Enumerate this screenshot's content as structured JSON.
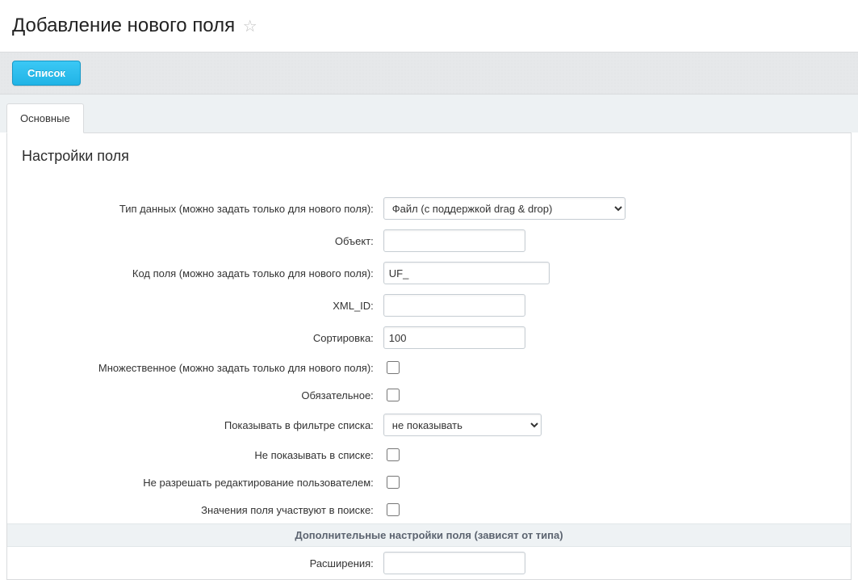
{
  "page": {
    "title": "Добавление нового поля"
  },
  "toolbar": {
    "list_label": "Список"
  },
  "tabs": {
    "main": "Основные"
  },
  "section": {
    "title": "Настройки поля",
    "sub_heading": "Дополнительные настройки поля (зависят от типа)"
  },
  "labels": {
    "data_type": "Тип данных (можно задать только для нового поля):",
    "object": "Объект:",
    "field_code": "Код поля (можно задать только для нового поля):",
    "xml_id": "XML_ID:",
    "sort": "Сортировка:",
    "multiple": "Множественное (можно задать только для нового поля):",
    "required": "Обязательное:",
    "show_filter": "Показывать в фильтре списка:",
    "hide_in_list": "Не показывать в списке:",
    "deny_user_edit": "Не разрешать редактирование пользователем:",
    "searchable": "Значения поля участвуют в поиске:",
    "extensions": "Расширения:"
  },
  "values": {
    "data_type_selected": "Файл (с поддержкой drag & drop)",
    "object": "",
    "field_code": "UF_",
    "xml_id": "",
    "sort": "100",
    "show_filter_selected": "не показывать",
    "extensions": ""
  }
}
